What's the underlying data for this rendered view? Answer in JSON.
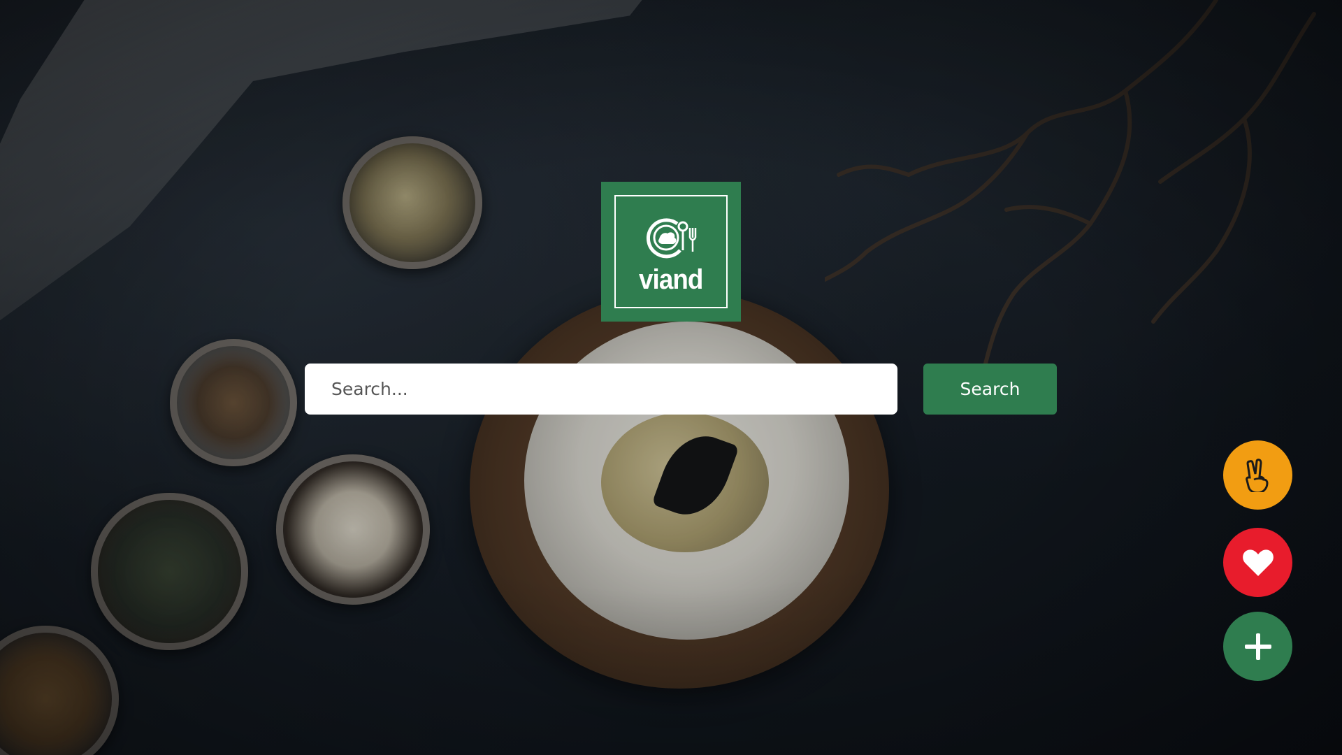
{
  "logo": {
    "text": "viand",
    "icon": "plate-fork-spoon-icon",
    "color": "#2f7d4f"
  },
  "search": {
    "placeholder": "Search...",
    "value": "",
    "button_label": "Search",
    "button_color": "#2f7d4f"
  },
  "fabs": [
    {
      "icon": "peace-hand-icon",
      "color": "#f29d12"
    },
    {
      "icon": "heart-icon",
      "color": "#e81c2c"
    },
    {
      "icon": "plus-icon",
      "color": "#2f7d4f"
    }
  ]
}
